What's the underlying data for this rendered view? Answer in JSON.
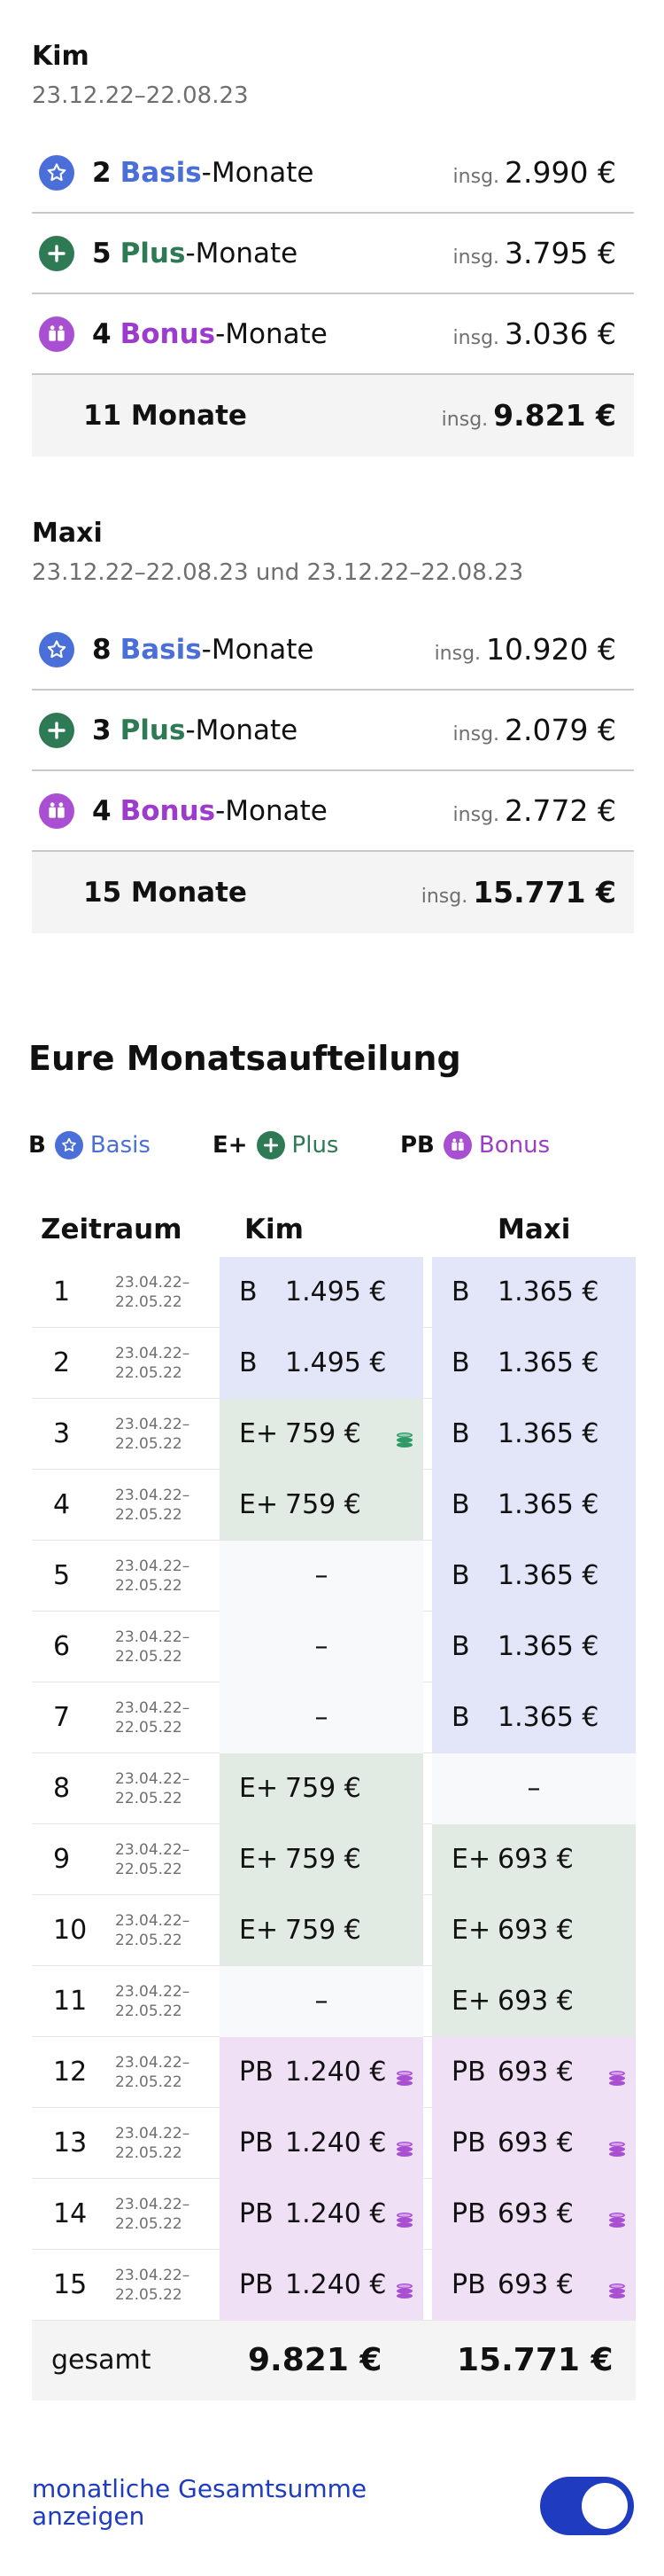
{
  "parents": [
    {
      "name": "Kim",
      "dates": "23.12.22–22.08.23",
      "rows": [
        {
          "type": "basis",
          "count": "2",
          "keyword": "Basis",
          "suffix": "-Monate",
          "insg": "insg.",
          "amount": "2.990 €",
          "icon": "star-icon"
        },
        {
          "type": "plus",
          "count": "5",
          "keyword": "Plus",
          "suffix": "-Monate",
          "insg": "insg.",
          "amount": "3.795 €",
          "icon": "plus-icon"
        },
        {
          "type": "bonus",
          "count": "4",
          "keyword": "Bonus",
          "suffix": "-Monate",
          "insg": "insg.",
          "amount": "3.036 €",
          "icon": "people-icon"
        }
      ],
      "total": {
        "label": "11 Monate",
        "insg": "insg.",
        "amount": "9.821 €"
      }
    },
    {
      "name": "Maxi",
      "dates": "23.12.22–22.08.23 und 23.12.22–22.08.23",
      "rows": [
        {
          "type": "basis",
          "count": "8",
          "keyword": "Basis",
          "suffix": "-Monate",
          "insg": "insg.",
          "amount": "10.920 €",
          "icon": "star-icon"
        },
        {
          "type": "plus",
          "count": "3",
          "keyword": "Plus",
          "suffix": "-Monate",
          "insg": "insg.",
          "amount": "2.079 €",
          "icon": "plus-icon"
        },
        {
          "type": "bonus",
          "count": "4",
          "keyword": "Bonus",
          "suffix": "-Monate",
          "insg": "insg.",
          "amount": "2.772 €",
          "icon": "people-icon"
        }
      ],
      "total": {
        "label": "15 Monate",
        "insg": "insg.",
        "amount": "15.771 €"
      }
    }
  ],
  "section_title": "Eure Monatsaufteilung",
  "legend": [
    {
      "abbr": "B",
      "label": "Basis",
      "type": "basis"
    },
    {
      "abbr": "E+",
      "label": "Plus",
      "type": "plus"
    },
    {
      "abbr": "PB",
      "label": "Bonus",
      "type": "bonus"
    }
  ],
  "table": {
    "headers": {
      "period": "Zeitraum",
      "kim": "Kim",
      "maxi": "Maxi"
    },
    "rows": [
      {
        "nr": "1",
        "date_from": "23.04.22–",
        "date_to": "22.05.22",
        "kim": {
          "type": "basis",
          "abbr": "B",
          "value": "1.495 €",
          "coin": false
        },
        "maxi": {
          "type": "basis",
          "abbr": "B",
          "value": "1.365 €",
          "coin": false
        }
      },
      {
        "nr": "2",
        "date_from": "23.04.22–",
        "date_to": "22.05.22",
        "kim": {
          "type": "basis",
          "abbr": "B",
          "value": "1.495 €",
          "coin": false
        },
        "maxi": {
          "type": "basis",
          "abbr": "B",
          "value": "1.365 €",
          "coin": false
        }
      },
      {
        "nr": "3",
        "date_from": "23.04.22–",
        "date_to": "22.05.22",
        "kim": {
          "type": "plus",
          "abbr": "E+",
          "value": "759 €",
          "coin": true
        },
        "maxi": {
          "type": "basis",
          "abbr": "B",
          "value": "1.365 €",
          "coin": false
        }
      },
      {
        "nr": "4",
        "date_from": "23.04.22–",
        "date_to": "22.05.22",
        "kim": {
          "type": "plus",
          "abbr": "E+",
          "value": "759 €",
          "coin": false
        },
        "maxi": {
          "type": "basis",
          "abbr": "B",
          "value": "1.365 €",
          "coin": false
        }
      },
      {
        "nr": "5",
        "date_from": "23.04.22–",
        "date_to": "22.05.22",
        "kim": {
          "type": "none",
          "abbr": "",
          "value": "–",
          "coin": false
        },
        "maxi": {
          "type": "basis",
          "abbr": "B",
          "value": "1.365 €",
          "coin": false
        }
      },
      {
        "nr": "6",
        "date_from": "23.04.22–",
        "date_to": "22.05.22",
        "kim": {
          "type": "none",
          "abbr": "",
          "value": "–",
          "coin": false
        },
        "maxi": {
          "type": "basis",
          "abbr": "B",
          "value": "1.365 €",
          "coin": false
        }
      },
      {
        "nr": "7",
        "date_from": "23.04.22–",
        "date_to": "22.05.22",
        "kim": {
          "type": "none",
          "abbr": "",
          "value": "–",
          "coin": false
        },
        "maxi": {
          "type": "basis",
          "abbr": "B",
          "value": "1.365 €",
          "coin": false
        }
      },
      {
        "nr": "8",
        "date_from": "23.04.22–",
        "date_to": "22.05.22",
        "kim": {
          "type": "plus",
          "abbr": "E+",
          "value": "759 €",
          "coin": false
        },
        "maxi": {
          "type": "none",
          "abbr": "",
          "value": "–",
          "coin": false
        }
      },
      {
        "nr": "9",
        "date_from": "23.04.22–",
        "date_to": "22.05.22",
        "kim": {
          "type": "plus",
          "abbr": "E+",
          "value": "759 €",
          "coin": false
        },
        "maxi": {
          "type": "plus",
          "abbr": "E+",
          "value": "693 €",
          "coin": false
        }
      },
      {
        "nr": "10",
        "date_from": "23.04.22–",
        "date_to": "22.05.22",
        "kim": {
          "type": "plus",
          "abbr": "E+",
          "value": "759 €",
          "coin": false
        },
        "maxi": {
          "type": "plus",
          "abbr": "E+",
          "value": "693 €",
          "coin": false
        }
      },
      {
        "nr": "11",
        "date_from": "23.04.22–",
        "date_to": "22.05.22",
        "kim": {
          "type": "none",
          "abbr": "",
          "value": "–",
          "coin": false
        },
        "maxi": {
          "type": "plus",
          "abbr": "E+",
          "value": "693 €",
          "coin": false
        }
      },
      {
        "nr": "12",
        "date_from": "23.04.22–",
        "date_to": "22.05.22",
        "kim": {
          "type": "bonus",
          "abbr": "PB",
          "value": "1.240 €",
          "coin": true
        },
        "maxi": {
          "type": "bonus",
          "abbr": "PB",
          "value": "693 €",
          "coin": true
        }
      },
      {
        "nr": "13",
        "date_from": "23.04.22–",
        "date_to": "22.05.22",
        "kim": {
          "type": "bonus",
          "abbr": "PB",
          "value": "1.240 €",
          "coin": true
        },
        "maxi": {
          "type": "bonus",
          "abbr": "PB",
          "value": "693 €",
          "coin": true
        }
      },
      {
        "nr": "14",
        "date_from": "23.04.22–",
        "date_to": "22.05.22",
        "kim": {
          "type": "bonus",
          "abbr": "PB",
          "value": "1.240 €",
          "coin": true
        },
        "maxi": {
          "type": "bonus",
          "abbr": "PB",
          "value": "693 €",
          "coin": true
        }
      },
      {
        "nr": "15",
        "date_from": "23.04.22–",
        "date_to": "22.05.22",
        "kim": {
          "type": "bonus",
          "abbr": "PB",
          "value": "1.240 €",
          "coin": true
        },
        "maxi": {
          "type": "bonus",
          "abbr": "PB",
          "value": "693 €",
          "coin": true
        }
      }
    ],
    "footer": {
      "label": "gesamt",
      "kim_total": "9.821 €",
      "maxi_total": "15.771 €"
    }
  },
  "toggle": {
    "label": "monatliche Gesamtsumme anzeigen",
    "on": true
  },
  "colors": {
    "basis": "#4a6fd9",
    "plus": "#2e7a55",
    "bonus": "#9c3bcc",
    "toggle": "#1f3bbf"
  }
}
